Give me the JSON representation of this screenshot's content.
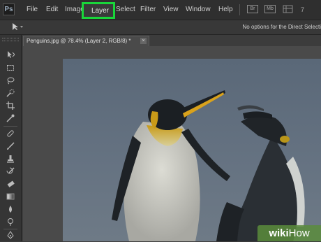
{
  "app": {
    "logo_text": "Ps"
  },
  "menu": {
    "items": [
      "File",
      "Edit",
      "Image",
      "Layer",
      "Select",
      "Filter",
      "View",
      "Window",
      "Help"
    ],
    "highlighted": "Layer"
  },
  "menubar_icons": [
    "bridge-icon",
    "mini-bridge-icon"
  ],
  "options_bar": {
    "text": "No options for the Direct Selecti"
  },
  "document": {
    "tab_title": "Penguins.jpg @ 78.4% (Layer 2, RGB/8) *",
    "close_glyph": "×"
  },
  "watermark": {
    "brand": "wiki",
    "suffix": "How"
  },
  "colors": {
    "highlight": "#19d63a",
    "menubar": "#2f2f2f",
    "workspace": "#4a4a4a"
  }
}
